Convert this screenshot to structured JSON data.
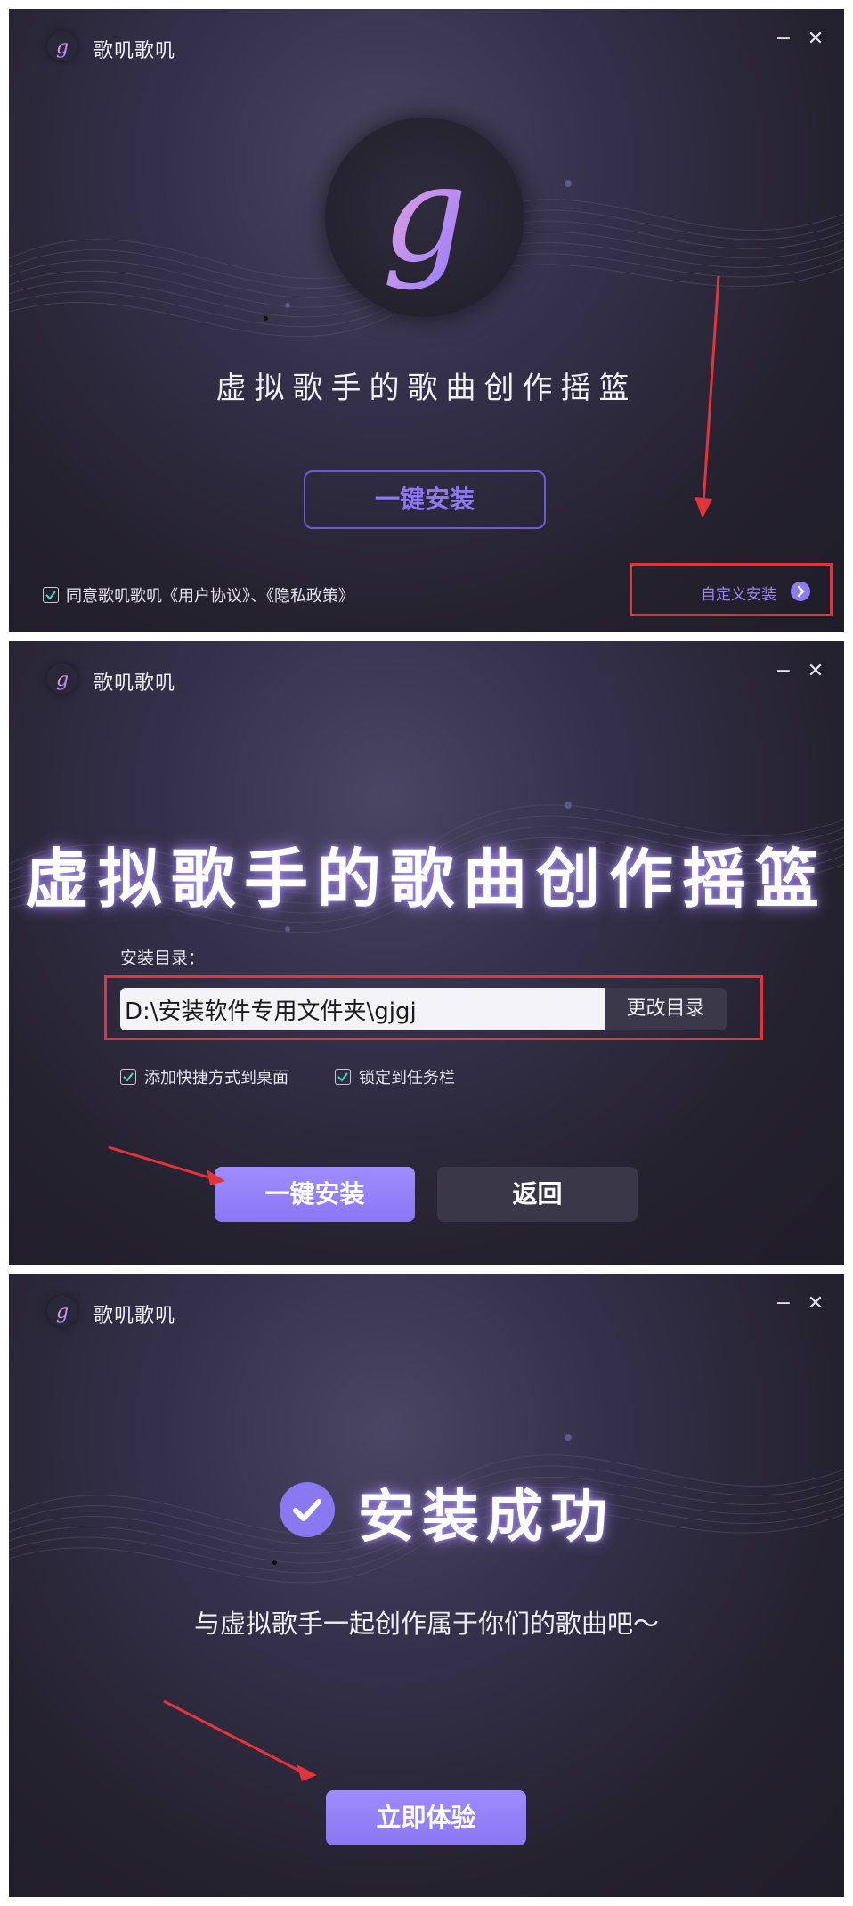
{
  "app": {
    "title": "歌叽歌叽",
    "logo_icon": "g-logo-icon"
  },
  "window_controls": {
    "minimize": "−",
    "close": "✕"
  },
  "screen1": {
    "slogan": "虚拟歌手的歌曲创作摇篮",
    "install_button": "一键安装",
    "agreement": "同意歌叽歌叽《用户协议》、《隐私政策》",
    "agreement_checked": true,
    "custom_install": "自定义安装"
  },
  "screen2": {
    "slogan": "虚拟歌手的歌曲创作摇篮",
    "dir_label": "安装目录：",
    "dir_value": "D:\\安装软件专用文件夹\\gjgj",
    "change_dir_button": "更改目录",
    "options": [
      {
        "label": "添加快捷方式到桌面",
        "checked": true
      },
      {
        "label": "锁定到任务栏",
        "checked": true
      }
    ],
    "install_button": "一键安装",
    "back_button": "返回"
  },
  "screen3": {
    "success_title": "安装成功",
    "success_subtitle": "与虚拟歌手一起创作属于你们的歌曲吧～",
    "experience_button": "立即体验"
  },
  "colors": {
    "accent": "#8b77f2",
    "annotation_red": "#e4333a",
    "background": "#25222f"
  }
}
